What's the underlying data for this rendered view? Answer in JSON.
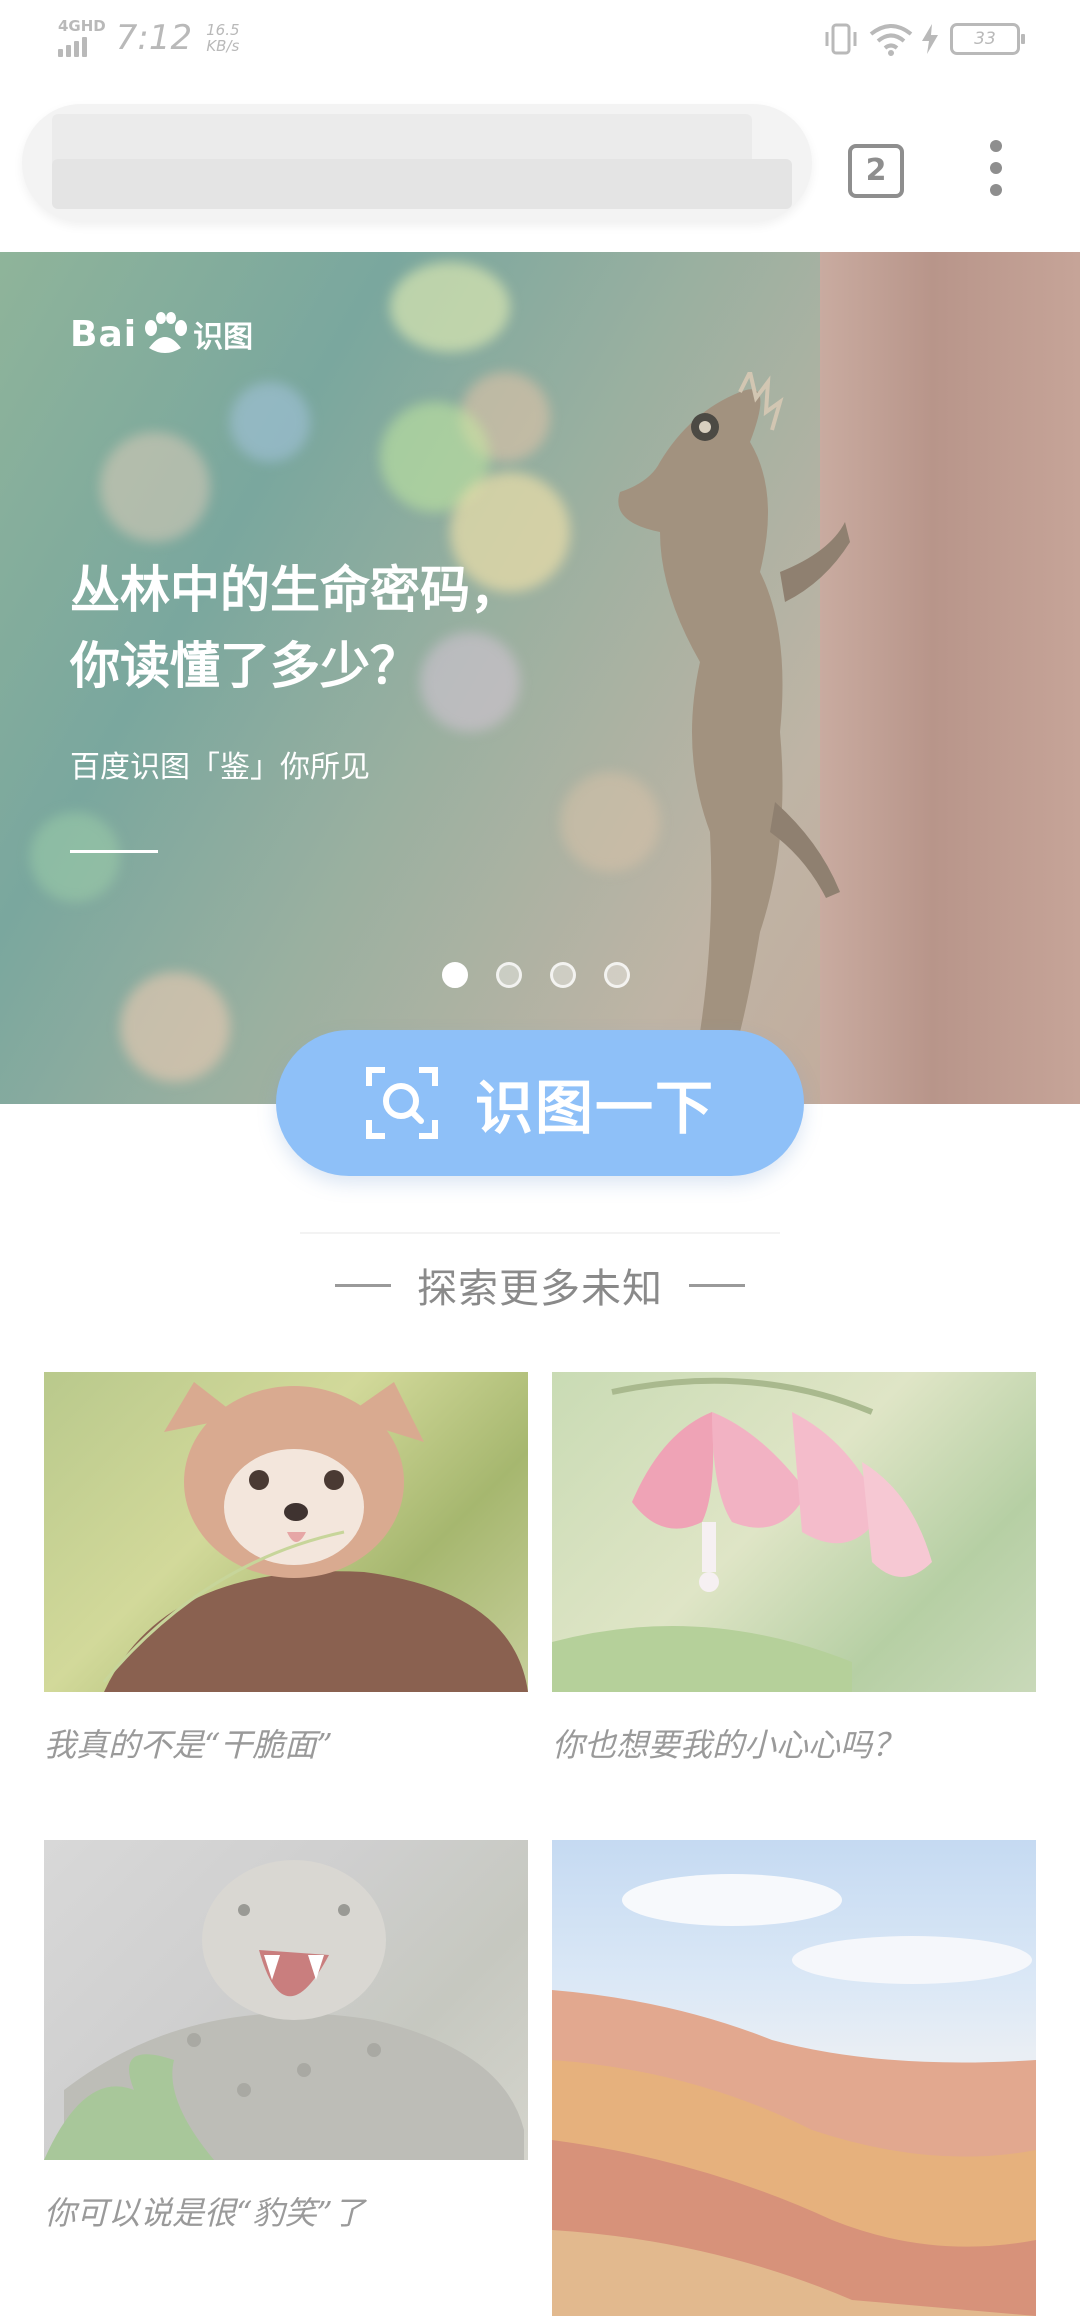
{
  "status_bar": {
    "network": "4GHD",
    "time": "7:12",
    "speed_value": "16.5",
    "speed_unit": "KB/s",
    "battery": "33"
  },
  "toolbar": {
    "tab_count": "2"
  },
  "banner": {
    "logo_text": "Bai",
    "logo_cn": "识图",
    "headline_line1": "丛林中的生命密码，",
    "headline_line2": "你读懂了多少？",
    "subline": "百度识图「鉴」你所见",
    "pages": 4,
    "active_page": 1
  },
  "identify": {
    "label": "识图一下"
  },
  "explore": {
    "title": "探索更多未知"
  },
  "cards": [
    {
      "caption": "我真的不是“干脆面”",
      "icon": "red-panda-photo"
    },
    {
      "caption": "你也想要我的小心心吗？",
      "icon": "bleeding-heart-flower-photo"
    },
    {
      "caption": "你可以说是很“豹笑”了",
      "icon": "snow-leopard-photo"
    },
    {
      "caption": "",
      "icon": "rainbow-mountains-photo"
    }
  ],
  "colors": {
    "accent": "#8ec0f8",
    "text_muted": "#8a8a8a"
  }
}
